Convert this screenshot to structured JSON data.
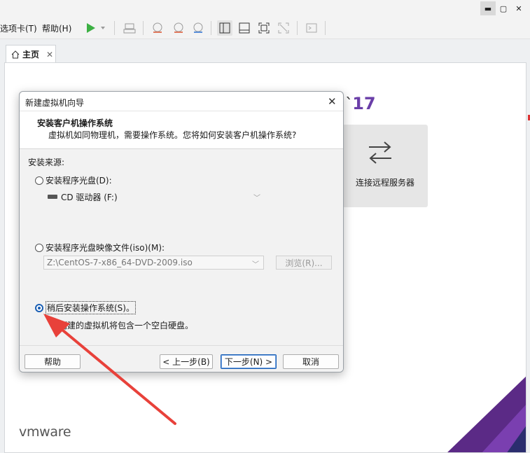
{
  "menu": {
    "tabs_menu": "选项卡(T)",
    "help_menu": "帮助(H)"
  },
  "tabs": {
    "home_label": "主页",
    "home_close": "✕"
  },
  "home": {
    "version": "17",
    "remote_server_label": "连接远程服务器",
    "brand_logo": "vmware"
  },
  "dialog": {
    "title": "新建虚拟机向导",
    "heading": "安装客户机操作系统",
    "subheading": "虚拟机如同物理机，需要操作系统。您将如何安装客户机操作系统?",
    "section_label": "安装来源:",
    "option_disc": "安装程序光盘(D):",
    "disc_drive_value": "CD 驱动器 (F:)",
    "option_iso": "安装程序光盘映像文件(iso)(M):",
    "iso_path_value": "Z:\\CentOS-7-x86_64-DVD-2009.iso",
    "browse_label": "浏览(R)...",
    "option_later": "稍后安装操作系统(S)。",
    "option_later_note": "创建的虚拟机将包含一个空白硬盘。",
    "selected_option": "later",
    "buttons": {
      "help": "帮助",
      "back": "< 上一步(B)",
      "next": "下一步(N) >",
      "cancel": "取消"
    }
  },
  "colors": {
    "accent_blue": "#1a5fb4",
    "brand_purple": "#6a3ea8",
    "annotation_red": "#e8413a",
    "play_green": "#3cb043"
  }
}
